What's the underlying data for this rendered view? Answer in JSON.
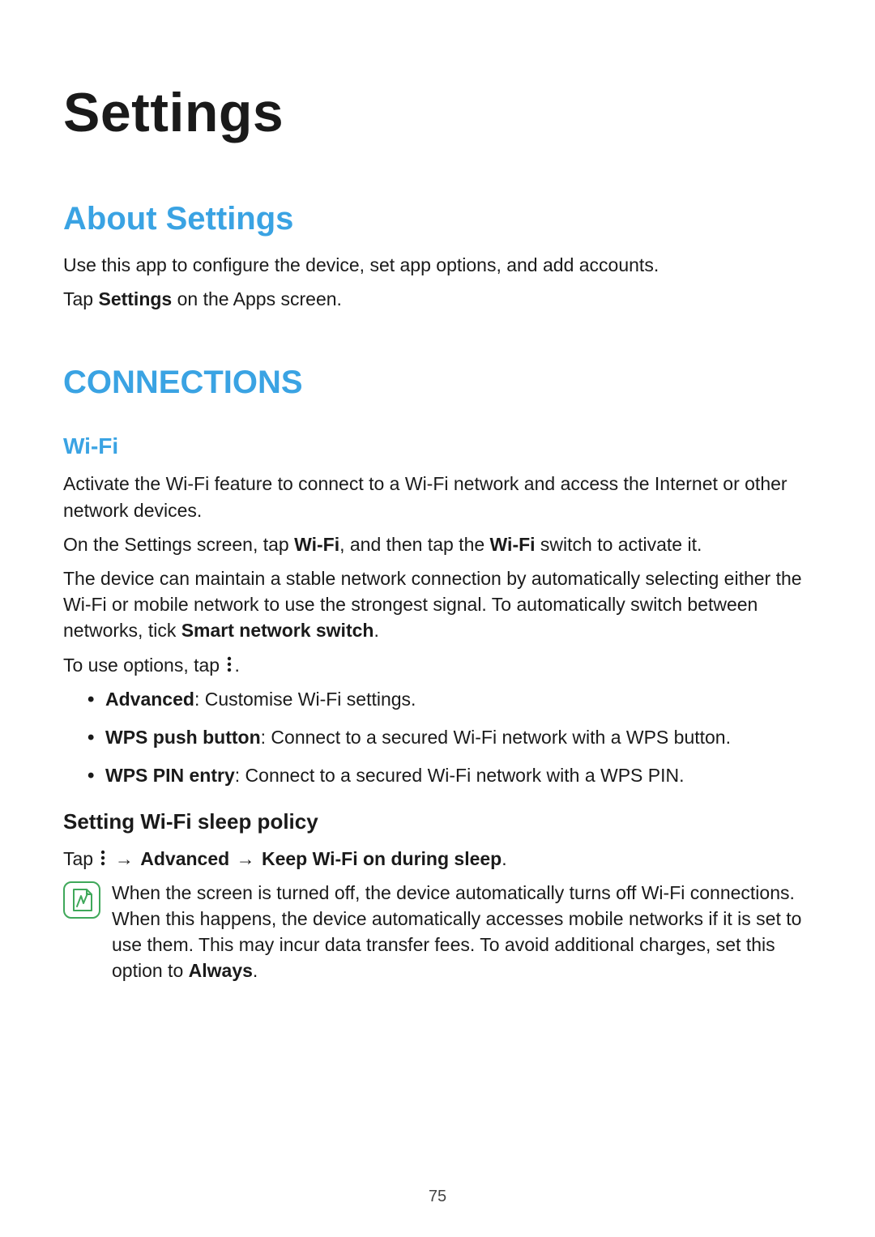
{
  "page": {
    "title": "Settings",
    "number": "75"
  },
  "about": {
    "heading": "About Settings",
    "p1": "Use this app to configure the device, set app options, and add accounts.",
    "p2_prefix": "Tap ",
    "p2_bold": "Settings",
    "p2_suffix": " on the Apps screen."
  },
  "connections": {
    "heading": "CONNECTIONS",
    "wifi": {
      "heading": "Wi-Fi",
      "p1": "Activate the Wi-Fi feature to connect to a Wi-Fi network and access the Internet or other network devices.",
      "p2_a": "On the Settings screen, tap ",
      "p2_b": "Wi-Fi",
      "p2_c": ", and then tap the ",
      "p2_d": "Wi-Fi",
      "p2_e": " switch to activate it.",
      "p3_a": "The device can maintain a stable network connection by automatically selecting either the Wi-Fi or mobile network to use the strongest signal. To automatically switch between networks, tick ",
      "p3_b": "Smart network switch",
      "p3_c": ".",
      "p4_prefix": "To use options, tap ",
      "p4_suffix": ".",
      "bullets": [
        {
          "bold": "Advanced",
          "rest": ": Customise Wi-Fi settings."
        },
        {
          "bold": "WPS push button",
          "rest": ": Connect to a secured Wi-Fi network with a WPS button."
        },
        {
          "bold": "WPS PIN entry",
          "rest": ": Connect to a secured Wi-Fi network with a WPS PIN."
        }
      ],
      "sleep": {
        "heading": "Setting Wi-Fi sleep policy",
        "nav_prefix": "Tap ",
        "nav_b1": "Advanced",
        "nav_b2": "Keep Wi-Fi on during sleep",
        "nav_suffix": ".",
        "note_a": "When the screen is turned off, the device automatically turns off Wi-Fi connections. When this happens, the device automatically accesses mobile networks if it is set to use them. This may incur data transfer fees. To avoid additional charges, set this option to ",
        "note_b": "Always",
        "note_c": "."
      }
    }
  },
  "icons": {
    "more": "more-options-icon",
    "note": "note-icon",
    "arrow_glyph": "→"
  }
}
